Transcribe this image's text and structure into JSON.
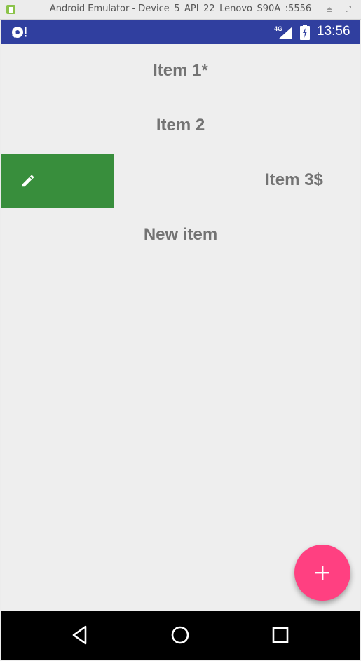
{
  "window": {
    "title": "Android Emulator - Device_5_API_22_Lenovo_S90A_:5556",
    "icon": "android-emulator-icon",
    "buttons": [
      "eject-icon",
      "resize-icon"
    ]
  },
  "status_bar": {
    "left_icon": "app-notification-icon",
    "network": "4G",
    "battery_icon": "battery-charging-icon",
    "time": "13:56",
    "color": "#303f9f"
  },
  "list": {
    "items": [
      {
        "label": "Item 1*"
      },
      {
        "label": "Item 2"
      },
      {
        "label": "Item 3$",
        "swiped": true,
        "action_icon": "edit-icon",
        "action_color": "#388e3c"
      },
      {
        "label": "New item"
      }
    ],
    "text_color": "#737373"
  },
  "fab": {
    "icon": "plus-icon",
    "color": "#ff4081"
  },
  "nav_bar": {
    "buttons": [
      "back-icon",
      "home-icon",
      "recents-icon"
    ]
  }
}
